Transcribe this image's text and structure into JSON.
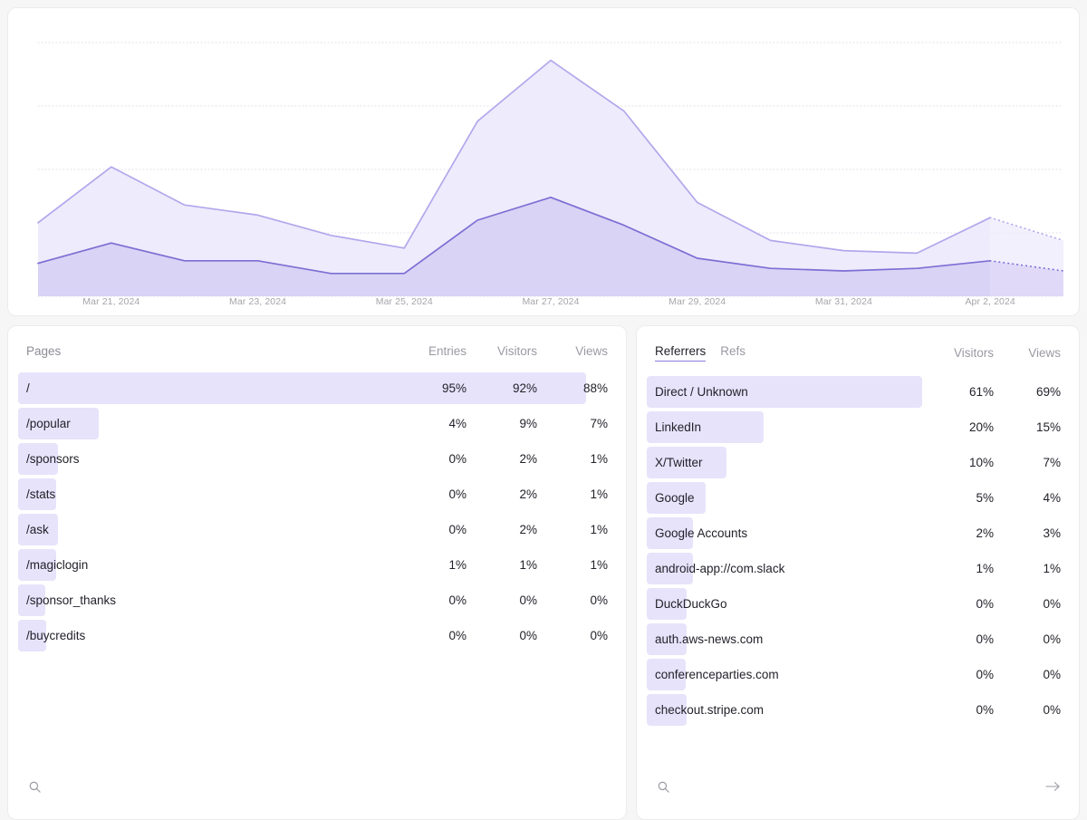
{
  "theme": {
    "page_bg": "#f6f6f7",
    "panel_bg": "#ffffff",
    "bar_fill": "#e7e3fb",
    "accent": "#8b7ee0",
    "visitors_line": "#7c6fd4",
    "visitors_fill": "#d9d3f5",
    "views_line": "#b1a8ec",
    "views_fill": "#eeebfc",
    "grid": "#d9d7e4",
    "muted_text": "#9a9aa3",
    "text": "#22222a"
  },
  "chart_data": {
    "type": "area",
    "title": "",
    "xlabel": "",
    "ylabel": "",
    "grid": true,
    "legend_position": "none",
    "x": [
      "Mar 20, 2024",
      "Mar 21, 2024",
      "Mar 22, 2024",
      "Mar 23, 2024",
      "Mar 24, 2024",
      "Mar 25, 2024",
      "Mar 26, 2024",
      "Mar 27, 2024",
      "Mar 28, 2024",
      "Mar 29, 2024",
      "Mar 30, 2024",
      "Mar 31, 2024",
      "Apr 1, 2024",
      "Apr 2, 2024",
      "Apr 3, 2024"
    ],
    "tick_labels": [
      "Mar 21, 2024",
      "Mar 23, 2024",
      "Mar 25, 2024",
      "Mar 27, 2024",
      "Mar 29, 2024",
      "Mar 31, 2024",
      "Apr 2, 2024"
    ],
    "tick_indices": [
      1,
      3,
      5,
      7,
      9,
      11,
      13
    ],
    "ylim": [
      0,
      100
    ],
    "gridline_values": [
      100,
      75,
      50,
      25,
      0
    ],
    "projected_from_index": 13,
    "series": [
      {
        "name": "Views",
        "line_color": "#b1a8ec",
        "fill_color": "#eeebfc",
        "values": [
          29,
          51,
          36,
          32,
          24,
          19,
          69,
          93,
          73,
          37,
          22,
          18,
          17,
          31,
          22
        ]
      },
      {
        "name": "Visitors",
        "line_color": "#7c6fd4",
        "fill_color": "#d9d3f5",
        "values": [
          13,
          21,
          14,
          14,
          9,
          9,
          30,
          39,
          28,
          15,
          11,
          10,
          11,
          14,
          10
        ]
      }
    ]
  },
  "pages_panel": {
    "title": "Pages",
    "columns": [
      "Entries",
      "Visitors",
      "Views"
    ],
    "rows": [
      {
        "label": "/",
        "entries": "95%",
        "visitors": "92%",
        "views": "88%",
        "bar_pct": 95
      },
      {
        "label": "/popular",
        "entries": "4%",
        "visitors": "9%",
        "views": "7%",
        "bar_pct": 13.5
      },
      {
        "label": "/sponsors",
        "entries": "0%",
        "visitors": "2%",
        "views": "1%",
        "bar_pct": 6.6
      },
      {
        "label": "/stats",
        "entries": "0%",
        "visitors": "2%",
        "views": "1%",
        "bar_pct": 6.4
      },
      {
        "label": "/ask",
        "entries": "0%",
        "visitors": "2%",
        "views": "1%",
        "bar_pct": 6.6
      },
      {
        "label": "/magiclogin",
        "entries": "1%",
        "visitors": "1%",
        "views": "1%",
        "bar_pct": 6.4
      },
      {
        "label": "/sponsor_thanks",
        "entries": "0%",
        "visitors": "0%",
        "views": "0%",
        "bar_pct": 4.6
      },
      {
        "label": "/buycredits",
        "entries": "0%",
        "visitors": "0%",
        "views": "0%",
        "bar_pct": 4.7
      }
    ],
    "search_icon": "search-icon"
  },
  "referrers_panel": {
    "tabs": [
      {
        "label": "Referrers",
        "active": true
      },
      {
        "label": "Refs",
        "active": false
      }
    ],
    "columns": [
      "Visitors",
      "Views"
    ],
    "rows": [
      {
        "label": "Direct / Unknown",
        "visitors": "61%",
        "views": "69%",
        "bar_pct": 63.0
      },
      {
        "label": "LinkedIn",
        "visitors": "20%",
        "views": "15%",
        "bar_pct": 26.8
      },
      {
        "label": "X/Twitter",
        "visitors": "10%",
        "views": "7%",
        "bar_pct": 18.3
      },
      {
        "label": "Google",
        "visitors": "5%",
        "views": "4%",
        "bar_pct": 13.4
      },
      {
        "label": "Google Accounts",
        "visitors": "2%",
        "views": "3%",
        "bar_pct": 10.6
      },
      {
        "label": "android-app://com.slack",
        "visitors": "1%",
        "views": "1%",
        "bar_pct": 10.6
      },
      {
        "label": "DuckDuckGo",
        "visitors": "0%",
        "views": "0%",
        "bar_pct": 9.2
      },
      {
        "label": "auth.aws-news.com",
        "visitors": "0%",
        "views": "0%",
        "bar_pct": 9.2
      },
      {
        "label": "conferenceparties.com",
        "visitors": "0%",
        "views": "0%",
        "bar_pct": 9.0
      },
      {
        "label": "checkout.stripe.com",
        "visitors": "0%",
        "views": "0%",
        "bar_pct": 9.2
      }
    ],
    "search_icon": "search-icon",
    "next_icon": "arrow-right-icon"
  }
}
